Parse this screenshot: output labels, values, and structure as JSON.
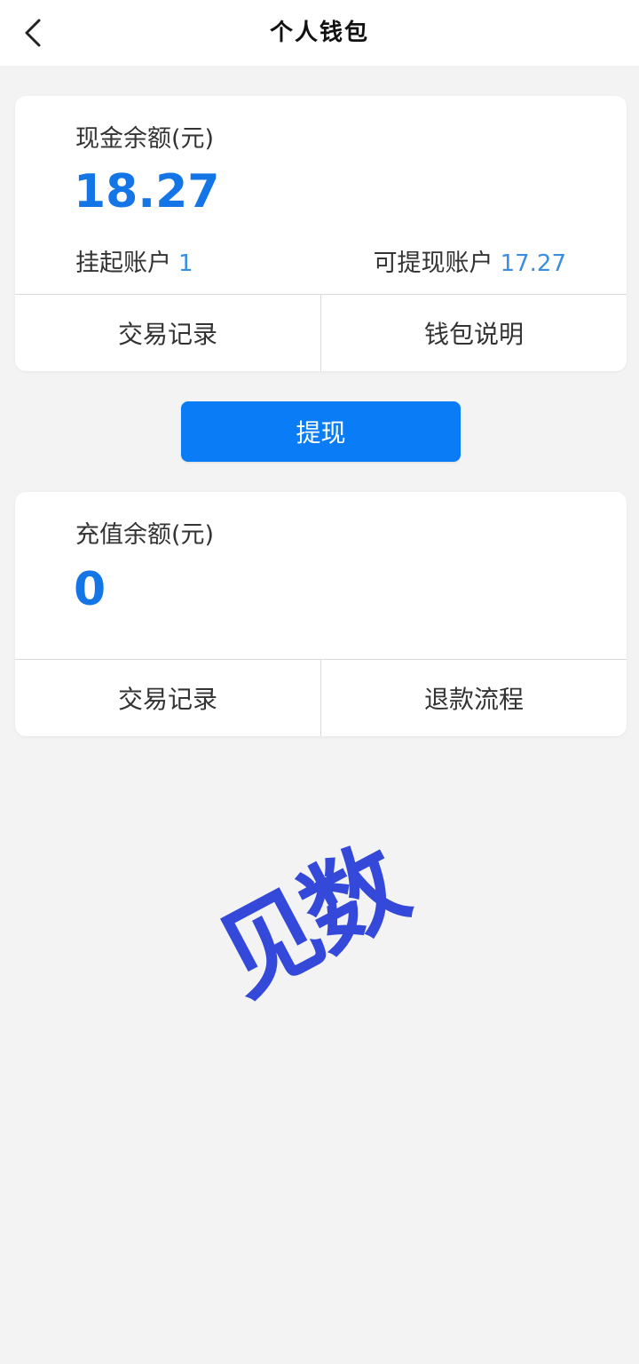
{
  "header": {
    "title": "个人钱包",
    "back_icon": "chevron-left-icon"
  },
  "cash_card": {
    "label": "现金余额(元)",
    "amount": "18.27",
    "suspended_label": "挂起账户",
    "suspended_value": "1",
    "withdrawable_label": "可提现账户",
    "withdrawable_value": "17.27",
    "footer": {
      "left": "交易记录",
      "right": "钱包说明"
    }
  },
  "withdraw_button": "提现",
  "recharge_card": {
    "label": "充值余额(元)",
    "amount": "0",
    "footer": {
      "left": "交易记录",
      "right": "退款流程"
    }
  },
  "stamp": {
    "text": "见数"
  },
  "colors": {
    "accent": "#1475e6",
    "button": "#0a7cf5",
    "sub_value": "#3a8ee0",
    "stamp": "#3448d9",
    "background": "#f3f3f4"
  }
}
